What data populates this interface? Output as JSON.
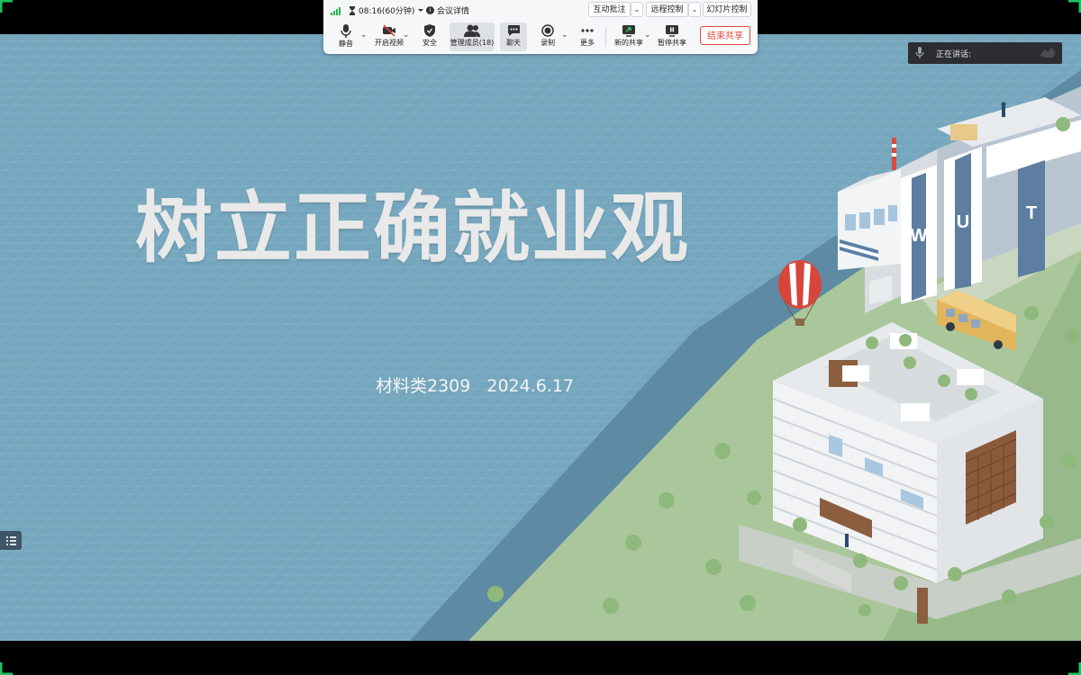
{
  "toolbar": {
    "timer": "08:16(60分钟)",
    "meeting_details": "会议详情",
    "annotate_label": "互动批注",
    "remote_control_label": "远程控制",
    "slide_control_label": "幻灯片控制",
    "tools": {
      "mute": "静音",
      "video": "开启视频",
      "security": "安全",
      "members": "管理成员(18)",
      "chat": "聊天",
      "record": "录制",
      "more": "更多",
      "new_share": "新的共享",
      "pause_share": "暂停共享"
    },
    "end_share_label": "结束共享"
  },
  "speaking": {
    "label": "正在讲话:"
  },
  "slide": {
    "title": "树立正确就业观",
    "class_name": "材料类2309",
    "date": "2024.6.17",
    "sign_letters": [
      "W",
      "U",
      "T"
    ]
  },
  "colors": {
    "accent_red": "#e0483b",
    "signal_green": "#2bb24c",
    "slide_background": "#74a6bd",
    "frame_corner": "#1fc25f"
  }
}
